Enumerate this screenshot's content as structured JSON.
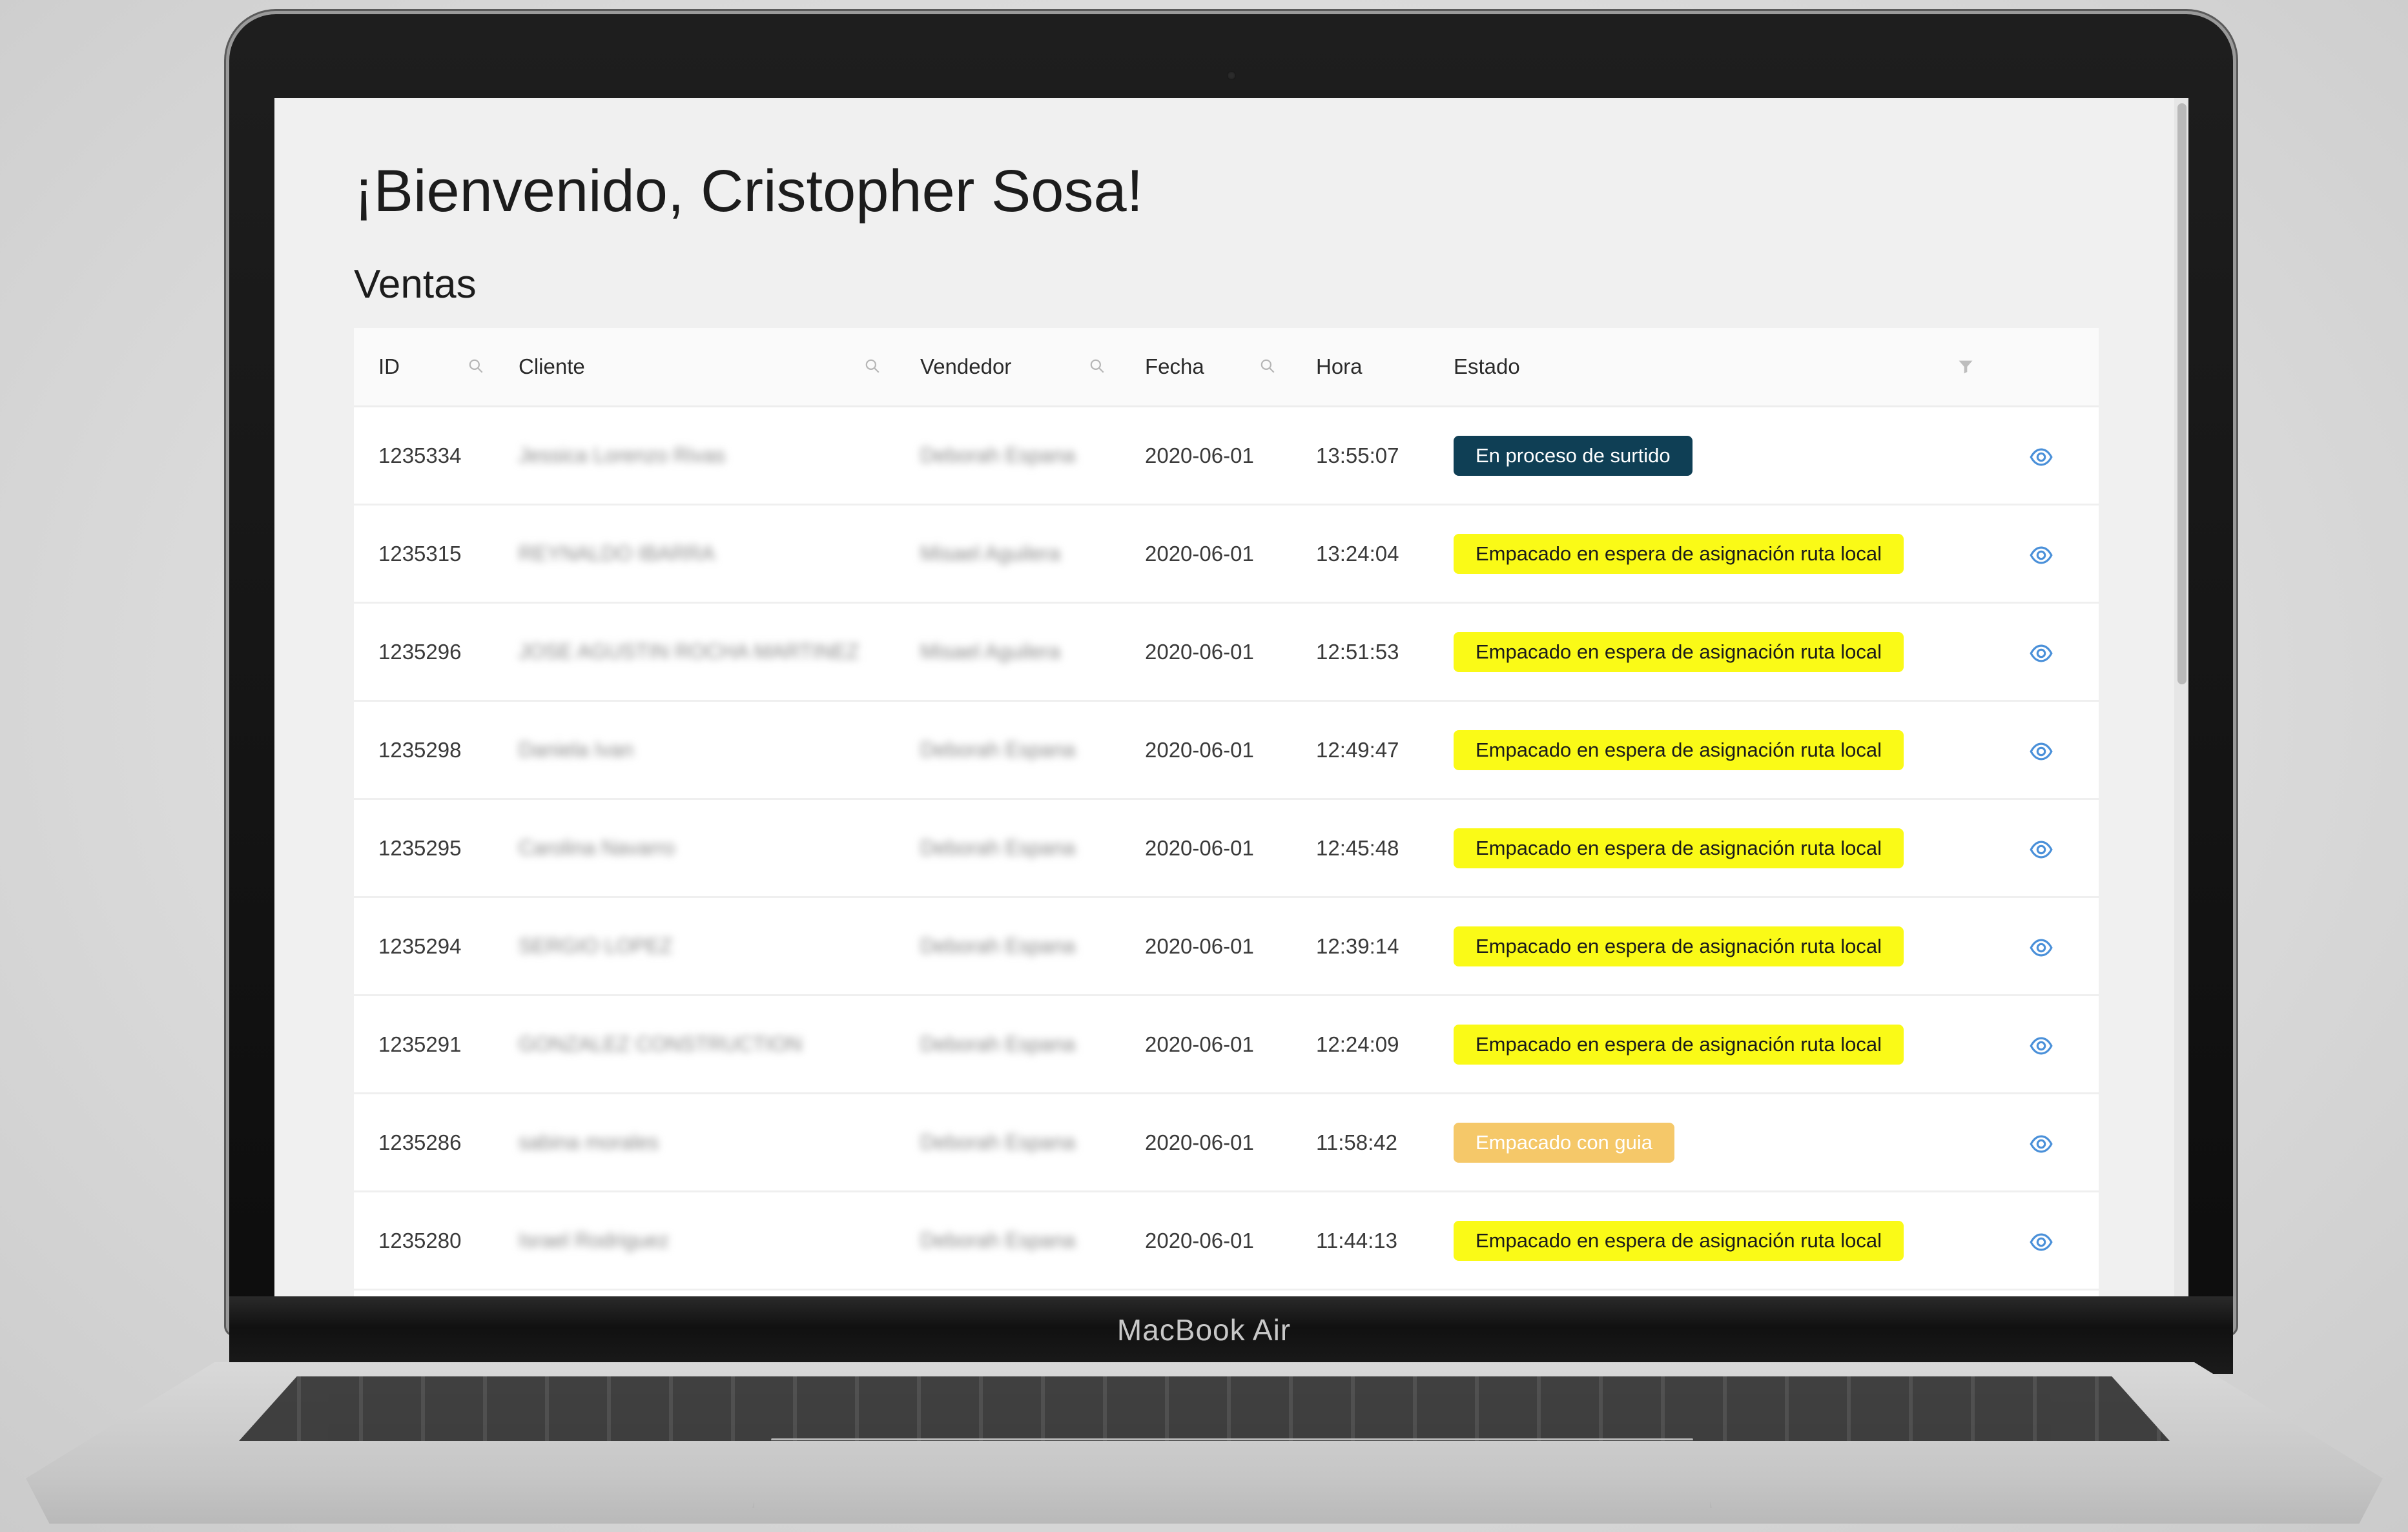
{
  "device": {
    "brand_label": "MacBook Air"
  },
  "page": {
    "welcome_title": "¡Bienvenido, Cristopher Sosa!",
    "section_title": "Ventas"
  },
  "table": {
    "columns": [
      "ID",
      "Cliente",
      "Vendedor",
      "Fecha",
      "Hora",
      "Estado"
    ],
    "search_icon": "search-icon",
    "filter_icon": "filter-icon",
    "view_icon": "eye-icon",
    "rows": [
      {
        "id": "1235334",
        "cliente": "Jessica Lorenzo Rivas",
        "vendedor": "Deborah Espana",
        "fecha": "2020-06-01",
        "hora": "13:55:07",
        "estado": "En proceso de surtido",
        "status_color": "#0f3f55"
      },
      {
        "id": "1235315",
        "cliente": "REYNALDO IBARRA",
        "vendedor": "Misael Aguilera",
        "fecha": "2020-06-01",
        "hora": "13:24:04",
        "estado": "Empacado en espera de asignación ruta local",
        "status_color": "#fafa17"
      },
      {
        "id": "1235296",
        "cliente": "JOSE AGUSTIN ROCHA MARTINEZ",
        "vendedor": "Misael Aguilera",
        "fecha": "2020-06-01",
        "hora": "12:51:53",
        "estado": "Empacado en espera de asignación ruta local",
        "status_color": "#fafa17"
      },
      {
        "id": "1235298",
        "cliente": "Daniela Ivan",
        "vendedor": "Deborah Espana",
        "fecha": "2020-06-01",
        "hora": "12:49:47",
        "estado": "Empacado en espera de asignación ruta local",
        "status_color": "#fafa17"
      },
      {
        "id": "1235295",
        "cliente": "Carolina Navarro",
        "vendedor": "Deborah Espana",
        "fecha": "2020-06-01",
        "hora": "12:45:48",
        "estado": "Empacado en espera de asignación ruta local",
        "status_color": "#fafa17"
      },
      {
        "id": "1235294",
        "cliente": "SERGIO LOPEZ",
        "vendedor": "Deborah Espana",
        "fecha": "2020-06-01",
        "hora": "12:39:14",
        "estado": "Empacado en espera de asignación ruta local",
        "status_color": "#fafa17"
      },
      {
        "id": "1235291",
        "cliente": "GONZALEZ CONSTRUCTION",
        "vendedor": "Deborah Espana",
        "fecha": "2020-06-01",
        "hora": "12:24:09",
        "estado": "Empacado en espera de asignación ruta local",
        "status_color": "#fafa17"
      },
      {
        "id": "1235286",
        "cliente": "sabina morales",
        "vendedor": "Deborah Espana",
        "fecha": "2020-06-01",
        "hora": "11:58:42",
        "estado": "Empacado con guia",
        "status_color": "#f5c869"
      },
      {
        "id": "1235280",
        "cliente": "Israel Rodriguez",
        "vendedor": "Deborah Espana",
        "fecha": "2020-06-01",
        "hora": "11:44:13",
        "estado": "Empacado en espera de asignación ruta local",
        "status_color": "#fafa17"
      }
    ]
  },
  "colors": {
    "status_dark": "#0f3f55",
    "status_yellow": "#fafa17",
    "status_orange": "#f5c869",
    "eye_icon": "#4a90d9"
  }
}
